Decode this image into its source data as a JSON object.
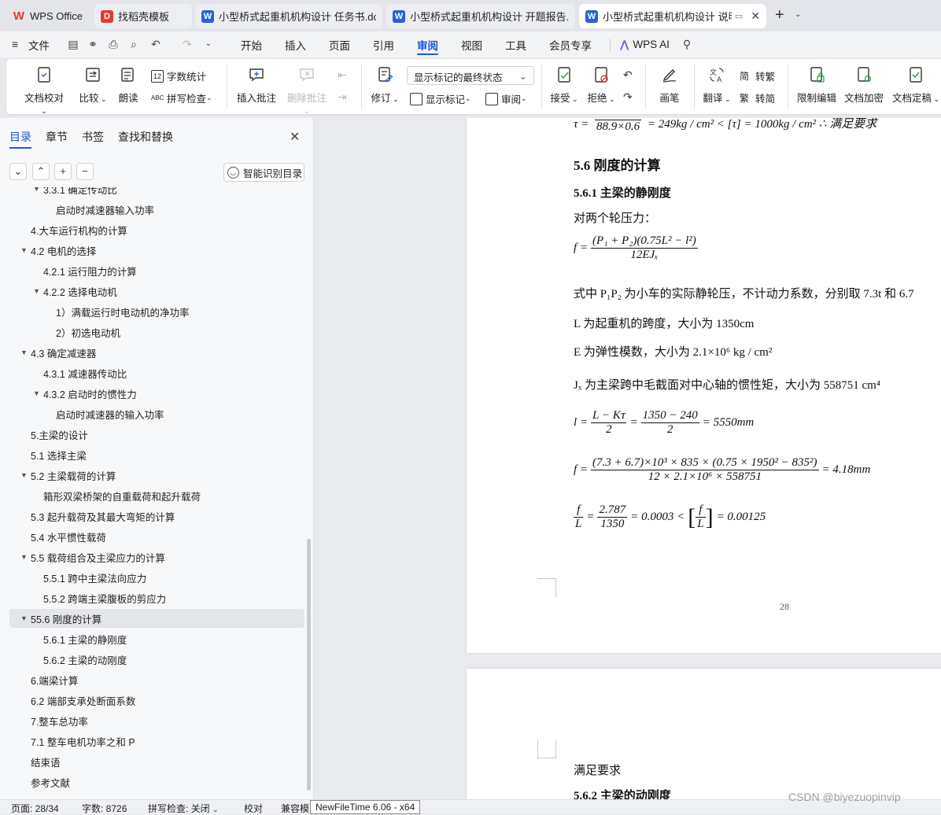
{
  "tabs": [
    {
      "label": "WPS Office",
      "icon": "wps-logo-icon",
      "color": "#e23b2e"
    },
    {
      "label": "找稻壳模板",
      "icon": "docer-icon",
      "color": "#e23b2e"
    },
    {
      "label": "小型桥式起重机机构设计 任务书.doc",
      "icon": "word-doc-icon",
      "color": "#2b5fd9"
    },
    {
      "label": "小型桥式起重机机构设计 开题报告.dc",
      "icon": "word-doc-icon",
      "color": "#2b5fd9"
    },
    {
      "label": "小型桥式起重机机构设计 说明",
      "icon": "word-doc-icon",
      "color": "#2b5fd9"
    }
  ],
  "menu": {
    "file": "文件",
    "items": [
      "开始",
      "插入",
      "页面",
      "引用",
      "审阅",
      "视图",
      "工具",
      "会员专享"
    ],
    "active": "审阅",
    "ai": "WPS AI"
  },
  "ribbon": {
    "doc_check": "文档校对",
    "compare": "比较",
    "read": "朗读",
    "word_count": "字数统计",
    "spell_check": "拼写检查",
    "insert_comment": "插入批注",
    "delete_comment": "删除批注",
    "track": "修订",
    "show_markup": "显示标记",
    "review": "审阅",
    "markup_state": "显示标记的最终状态",
    "accept": "接受",
    "reject": "拒绝",
    "pen": "画笔",
    "translate": "翻译",
    "to_trad": "转繁",
    "to_simp": "转简",
    "restrict": "限制编辑",
    "encrypt": "文档加密",
    "finalize": "文档定稿"
  },
  "sidebar": {
    "tabs": [
      "目录",
      "章节",
      "书签",
      "查找和替换"
    ],
    "smart_btn": "智能识别目录",
    "toc": [
      {
        "label": "3.3.1 确定传动比",
        "level": 2,
        "arrow": true
      },
      {
        "label": "启动时减速器输入功率",
        "level": 3,
        "arrow": false
      },
      {
        "label": "4.大车运行机构的计算",
        "level": 1,
        "arrow": false
      },
      {
        "label": "4.2 电机的选择",
        "level": 1,
        "arrow": true
      },
      {
        "label": "4.2.1 运行阻力的计算",
        "level": 2,
        "arrow": false
      },
      {
        "label": "4.2.2 选择电动机",
        "level": 2,
        "arrow": true
      },
      {
        "label": "1）满载运行时电动机的净功率",
        "level": 3,
        "arrow": false
      },
      {
        "label": "2）初选电动机",
        "level": 3,
        "arrow": false
      },
      {
        "label": "4.3 确定减速器",
        "level": 1,
        "arrow": true
      },
      {
        "label": "4.3.1 减速器传动比",
        "level": 2,
        "arrow": false
      },
      {
        "label": "4.3.2 启动时的惯性力",
        "level": 2,
        "arrow": true
      },
      {
        "label": "启动时减速器的输入功率",
        "level": 3,
        "arrow": false
      },
      {
        "label": "5.主梁的设计",
        "level": 1,
        "arrow": false
      },
      {
        "label": "5.1 选择主梁",
        "level": 1,
        "arrow": false
      },
      {
        "label": "5.2  主梁载荷的计算",
        "level": 1,
        "arrow": true
      },
      {
        "label": "箱形双梁桥架的自重载荷和起升载荷",
        "level": 2,
        "arrow": false
      },
      {
        "label": "5.3 起升载荷及其最大弯矩的计算",
        "level": 1,
        "arrow": false
      },
      {
        "label": "5.4 水平惯性载荷",
        "level": 1,
        "arrow": false
      },
      {
        "label": "5.5  载荷组合及主梁应力的计算",
        "level": 1,
        "arrow": true
      },
      {
        "label": "5.5.1  跨中主梁法向应力",
        "level": 2,
        "arrow": false
      },
      {
        "label": "5.5.2  跨端主梁腹板的剪应力",
        "level": 2,
        "arrow": false
      },
      {
        "label": "55.6  刚度的计算",
        "level": 1,
        "arrow": true,
        "selected": true
      },
      {
        "label": "5.6.1 主梁的静刚度",
        "level": 2,
        "arrow": false
      },
      {
        "label": "5.6.2  主梁的动刚度",
        "level": 2,
        "arrow": false
      },
      {
        "label": "6.端梁计算",
        "level": 1,
        "arrow": false
      },
      {
        "label": "6.2 端部支承处断面系数",
        "level": 1,
        "arrow": false
      },
      {
        "label": "7.整车总功率",
        "level": 1,
        "arrow": false
      },
      {
        "label": "7.1 整车电机功率之和 P",
        "level": 1,
        "arrow": false
      },
      {
        "label": "结束语",
        "level": 1,
        "arrow": false
      },
      {
        "label": "参考文献",
        "level": 1,
        "arrow": false
      }
    ]
  },
  "doc": {
    "top_partial_eq": "88.9×0.6",
    "top_partial_rhs": "= 249kg / cm² < [τ] = 1000kg / cm²  ∴ 满足要求",
    "h56": "5.6  刚度的计算",
    "h561": "5.6.1 主梁的静刚度",
    "p_two_wheels": "对两个轮压力：",
    "eq1_lhs": "f =",
    "eq1_num": "(P₁ + P₂)(0.75L² − l²)",
    "eq1_den": "12EJₓ",
    "p_where": "式中    P₁P₂ 为小车的实际静轮压，不计动力系数，分别取 7.3t 和 6.7",
    "p_L": "L 为起重机的跨度，大小为 1350cm",
    "p_E": "E 为弹性模数，大小为 2.1×10⁶ kg / cm²",
    "p_Jx": "Jₓ 为主梁跨中毛截面对中心轴的惯性矩，大小为 558751 cm⁴",
    "eq2_lhs": "l =",
    "eq2_num1": "L − Kᴛ",
    "eq2_den1": "2",
    "eq2_num2": "1350 − 240",
    "eq2_den2": "2",
    "eq2_rhs": "= 5550mm",
    "eq3_lhs": "f =",
    "eq3_num": "(7.3 + 6.7)×10³ × 835 × (0.75 × 1950² − 835²)",
    "eq3_den": "12 × 2.1×10⁶ × 558751",
    "eq3_rhs": "= 4.18mm",
    "eq4_num1": "f",
    "eq4_den1": "L",
    "eq4_num2": "2.787",
    "eq4_den2": "1350",
    "eq4_mid": "= 0.0003 <",
    "eq4_num3": "f",
    "eq4_den3": "L",
    "eq4_rhs": "= 0.00125",
    "page_number": "28",
    "p_satisfy": "满足要求",
    "h562": "5.6.2  主梁的动刚度"
  },
  "status": {
    "page": "页面: 28/34",
    "words": "字数: 8726",
    "spell": "拼写检查: 关闭",
    "proof": "校对",
    "compat": "兼容模",
    "tooltip": "NewFileTime 6.06 - x64"
  },
  "watermark": "CSDN @biyezuopinvip"
}
